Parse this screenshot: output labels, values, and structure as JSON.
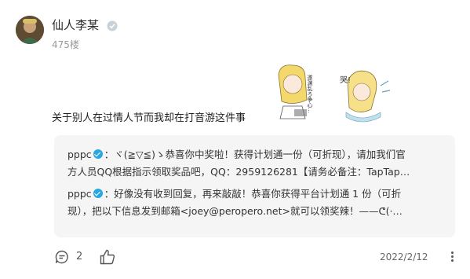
{
  "post": {
    "username": "仙人李某",
    "floor": "475楼",
    "content": "关于别人在过情人节而我却在打音游这件事",
    "sticker_text": "遂渊乱ろ争心…"
  },
  "replies": [
    {
      "author": "pppc",
      "lines": [
        "：ヾ(≧▽≦)ゝ恭喜你中奖啦！获得计划通一份（可折现），请加我们官",
        "方人员QQ根据指示领取奖品吧，QQ：2959126281【请务必备注：TapTap…"
      ]
    },
    {
      "author": "pppc",
      "lines": [
        "：好像没有收到回复，再来敲敲！恭喜你获得平台计划通 1 份（可折",
        "现），把以下信息发到邮箱<joey@peropero.net>就可以领奖辣！——ᕦ(·…"
      ]
    }
  ],
  "actions": {
    "comment_count": "2",
    "date": "2022/2/12"
  },
  "colors": {
    "verified_badge": "#2aa6e0",
    "reply_background": "#f5f5f5",
    "muted_text": "#9a9a9a"
  },
  "icons": [
    "user-badge-icon",
    "verified-icon",
    "comment-icon",
    "thumbs-up-icon",
    "more-icon"
  ]
}
